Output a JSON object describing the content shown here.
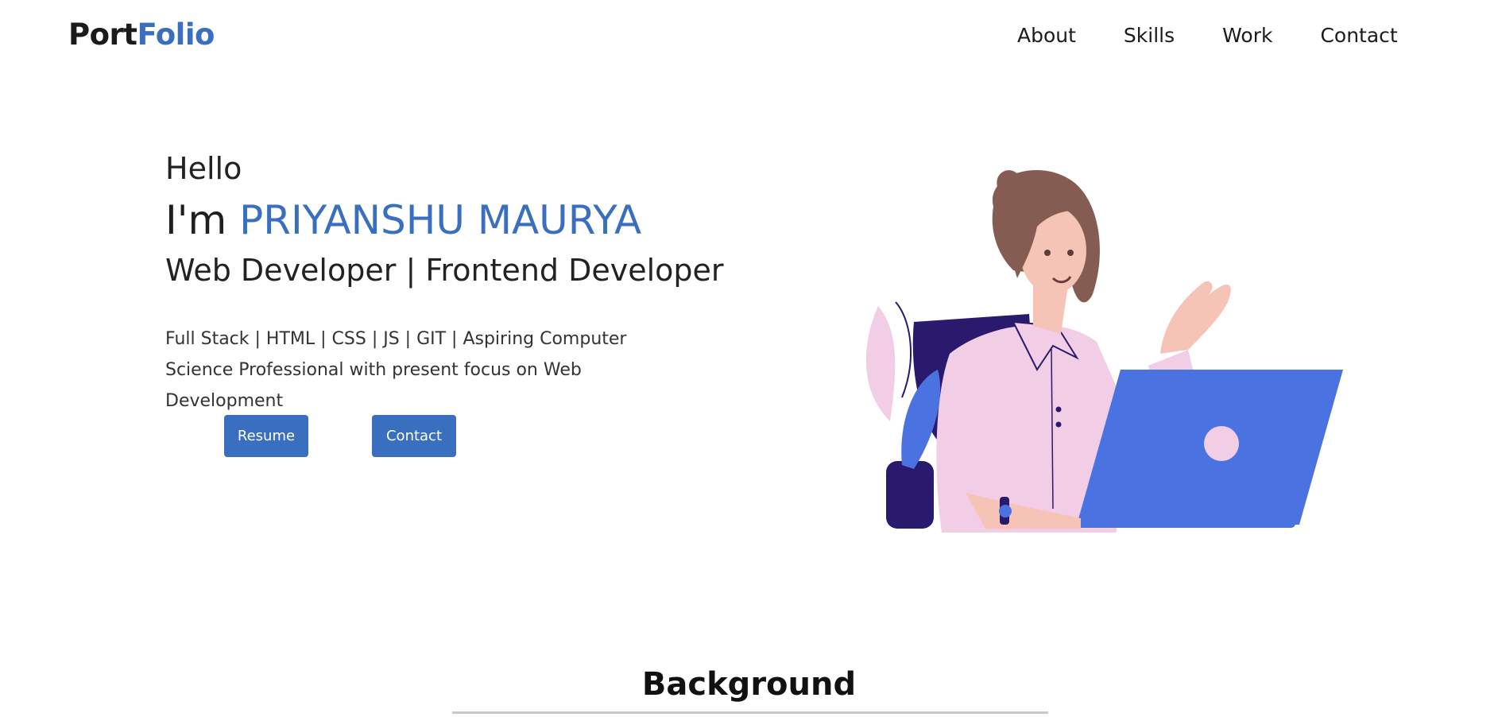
{
  "brand": {
    "logo_part1": "Port",
    "logo_part2": "Folio",
    "accent_color": "#3a6fc0"
  },
  "nav": {
    "items": [
      {
        "label": "About"
      },
      {
        "label": "Skills"
      },
      {
        "label": "Work"
      },
      {
        "label": "Contact"
      }
    ]
  },
  "hero": {
    "greeting": "Hello",
    "name_prefix": "I'm ",
    "name": "PRIYANSHU MAURYA",
    "role": "Web Developer | Frontend Developer",
    "description": "Full Stack | HTML | CSS | JS | GIT | Aspiring Computer Science Professional with present focus on Web Development",
    "buttons": {
      "resume_label": "Resume",
      "contact_label": "Contact"
    },
    "illustration_icon": "woman-with-laptop-illustration"
  },
  "section": {
    "title": "Background"
  }
}
